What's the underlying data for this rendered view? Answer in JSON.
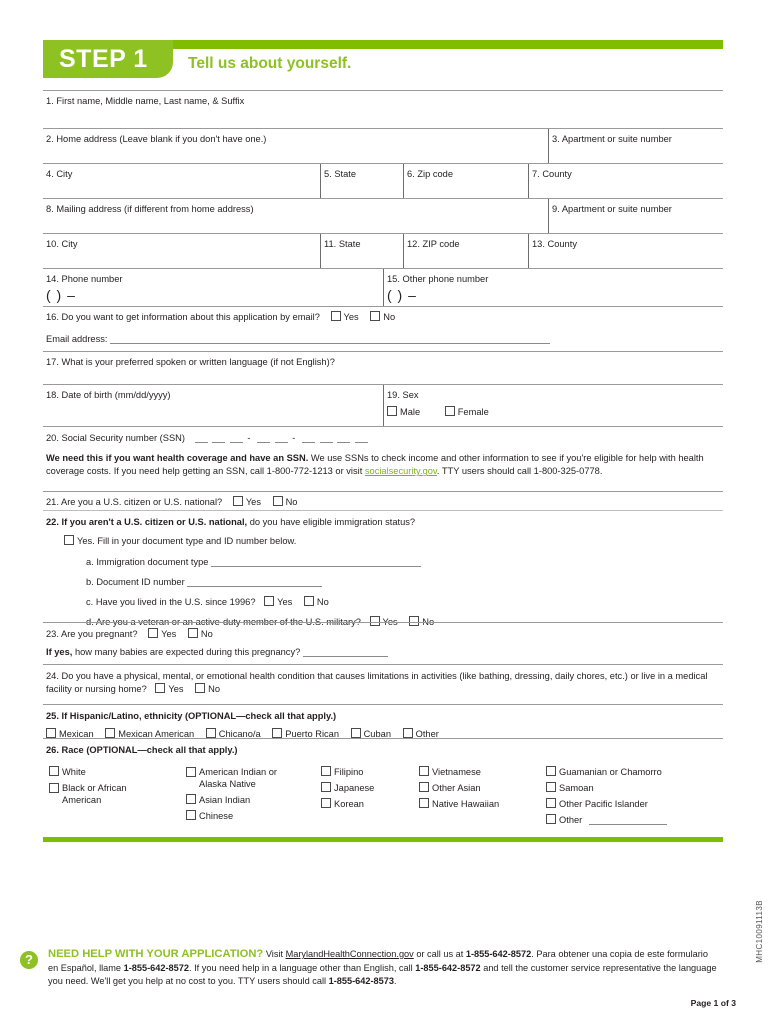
{
  "header": {
    "step_label": "STEP 1",
    "title": "Tell us about yourself."
  },
  "colors": {
    "green": "#8ec122",
    "bar_green": "#80bc00",
    "link_green": "#7cb518"
  },
  "fields": {
    "q1": "1. First name, Middle name, Last name, & Suffix",
    "q2": "2. Home address (Leave blank if you don't have one.)",
    "q3": "3. Apartment or suite number",
    "q4": "4. City",
    "q5": "5. State",
    "q6": "6. Zip code",
    "q7": "7. County",
    "q8": "8. Mailing address (if different from home address)",
    "q9": "9. Apartment or suite number",
    "q10": "10. City",
    "q11": "11. State",
    "q12": "12. ZIP code",
    "q13": "13. County",
    "q14": "14. Phone number",
    "q15": "15. Other phone number",
    "phone_mask": "(        )            –",
    "q16": "16. Do you want to get information about this application by email?",
    "q16_yes": "Yes",
    "q16_no": "No",
    "email_label": "Email address:",
    "q17": "17. What is your preferred spoken or written language (if not English)?",
    "q18": "18. Date of birth (mm/dd/yyyy)",
    "q19": "19. Sex",
    "q19_male": "Male",
    "q19_female": "Female",
    "q20": "20. Social Security number (SSN)",
    "q20_note_bold": "We need this if you want health coverage and have an SSN.",
    "q20_note_1": " We use SSNs to check income and other information to see if you're eligible for help with health coverage costs. If you need help getting an SSN, call 1-800-772-1213 or visit ",
    "q20_note_link": "socialsecurity.gov",
    "q20_note_2": ". TTY users should call 1-800-325-0778.",
    "q21": "21.  Are you a U.S. citizen or U.S. national?",
    "q21_yes": "Yes",
    "q21_no": "No",
    "q22_bold": "22. If you aren't a U.S. citizen or U.S. national,",
    "q22_rest": " do you have eligible immigration status?",
    "q22_yes": "Yes. Fill in your document type and ID number below.",
    "q22a": "a. Immigration document type",
    "q22b": "b. Document ID number",
    "q22c": "c. Have you lived in the U.S. since 1996?",
    "q22c_yes": "Yes",
    "q22c_no": "No",
    "q22d": "d. Are you a veteran or an active-duty member of the U.S. military?",
    "q22d_yes": "Yes",
    "q22d_no": "No",
    "q23": "23.  Are you pregnant?",
    "q23_yes": "Yes",
    "q23_no": "No",
    "q23_sub_bold": "If yes,",
    "q23_sub": " how many babies are expected during this pregnancy?",
    "q24": "24.  Do you have a physical, mental, or emotional health condition that causes limitations in activities (like bathing, dressing, daily chores, etc.) or live in a medical facility or nursing home?",
    "q24_yes": "Yes",
    "q24_no": "No",
    "q25": "25.  If Hispanic/Latino, ethnicity (OPTIONAL—check all that apply.)",
    "q25_options": [
      "Mexican",
      "Mexican American",
      "Chicano/a",
      "Puerto Rican",
      "Cuban",
      "Other"
    ],
    "q26": "26.  Race (OPTIONAL—check all that apply.)",
    "q26_col1": [
      "White",
      "Black or African American"
    ],
    "q26_col2": [
      "American Indian or Alaska Native",
      "Asian Indian",
      "Chinese"
    ],
    "q26_col3": [
      "Filipino",
      "Japanese",
      "Korean"
    ],
    "q26_col4": [
      "Vietnamese",
      "Other Asian",
      "Native Hawaiian"
    ],
    "q26_col5": [
      "Guamanian or Chamorro",
      "Samoan",
      "Other Pacific Islander",
      "Other"
    ]
  },
  "footer": {
    "help_icon": "?",
    "heading": "NEED HELP WITH YOUR APPLICATION?",
    "text_1": " Visit ",
    "link": "MarylandHealthConnection.gov",
    "text_2": " or call us at ",
    "phone_1": "1-855-642-8572",
    "text_3": ". Para obtener una copia de este formulario en Español, llame ",
    "phone_2": "1-855-642-8572",
    "text_4": ". If you need help in a language other than English, call ",
    "phone_3": "1-855-642-8572",
    "text_5": " and tell the customer service representative the language you need. We'll get you help at no cost to you. TTY users should call ",
    "phone_4": "1-855-642-8573",
    "text_6": ".",
    "page_number": "Page 1 of 3",
    "doc_id": "MHC10091113B"
  }
}
